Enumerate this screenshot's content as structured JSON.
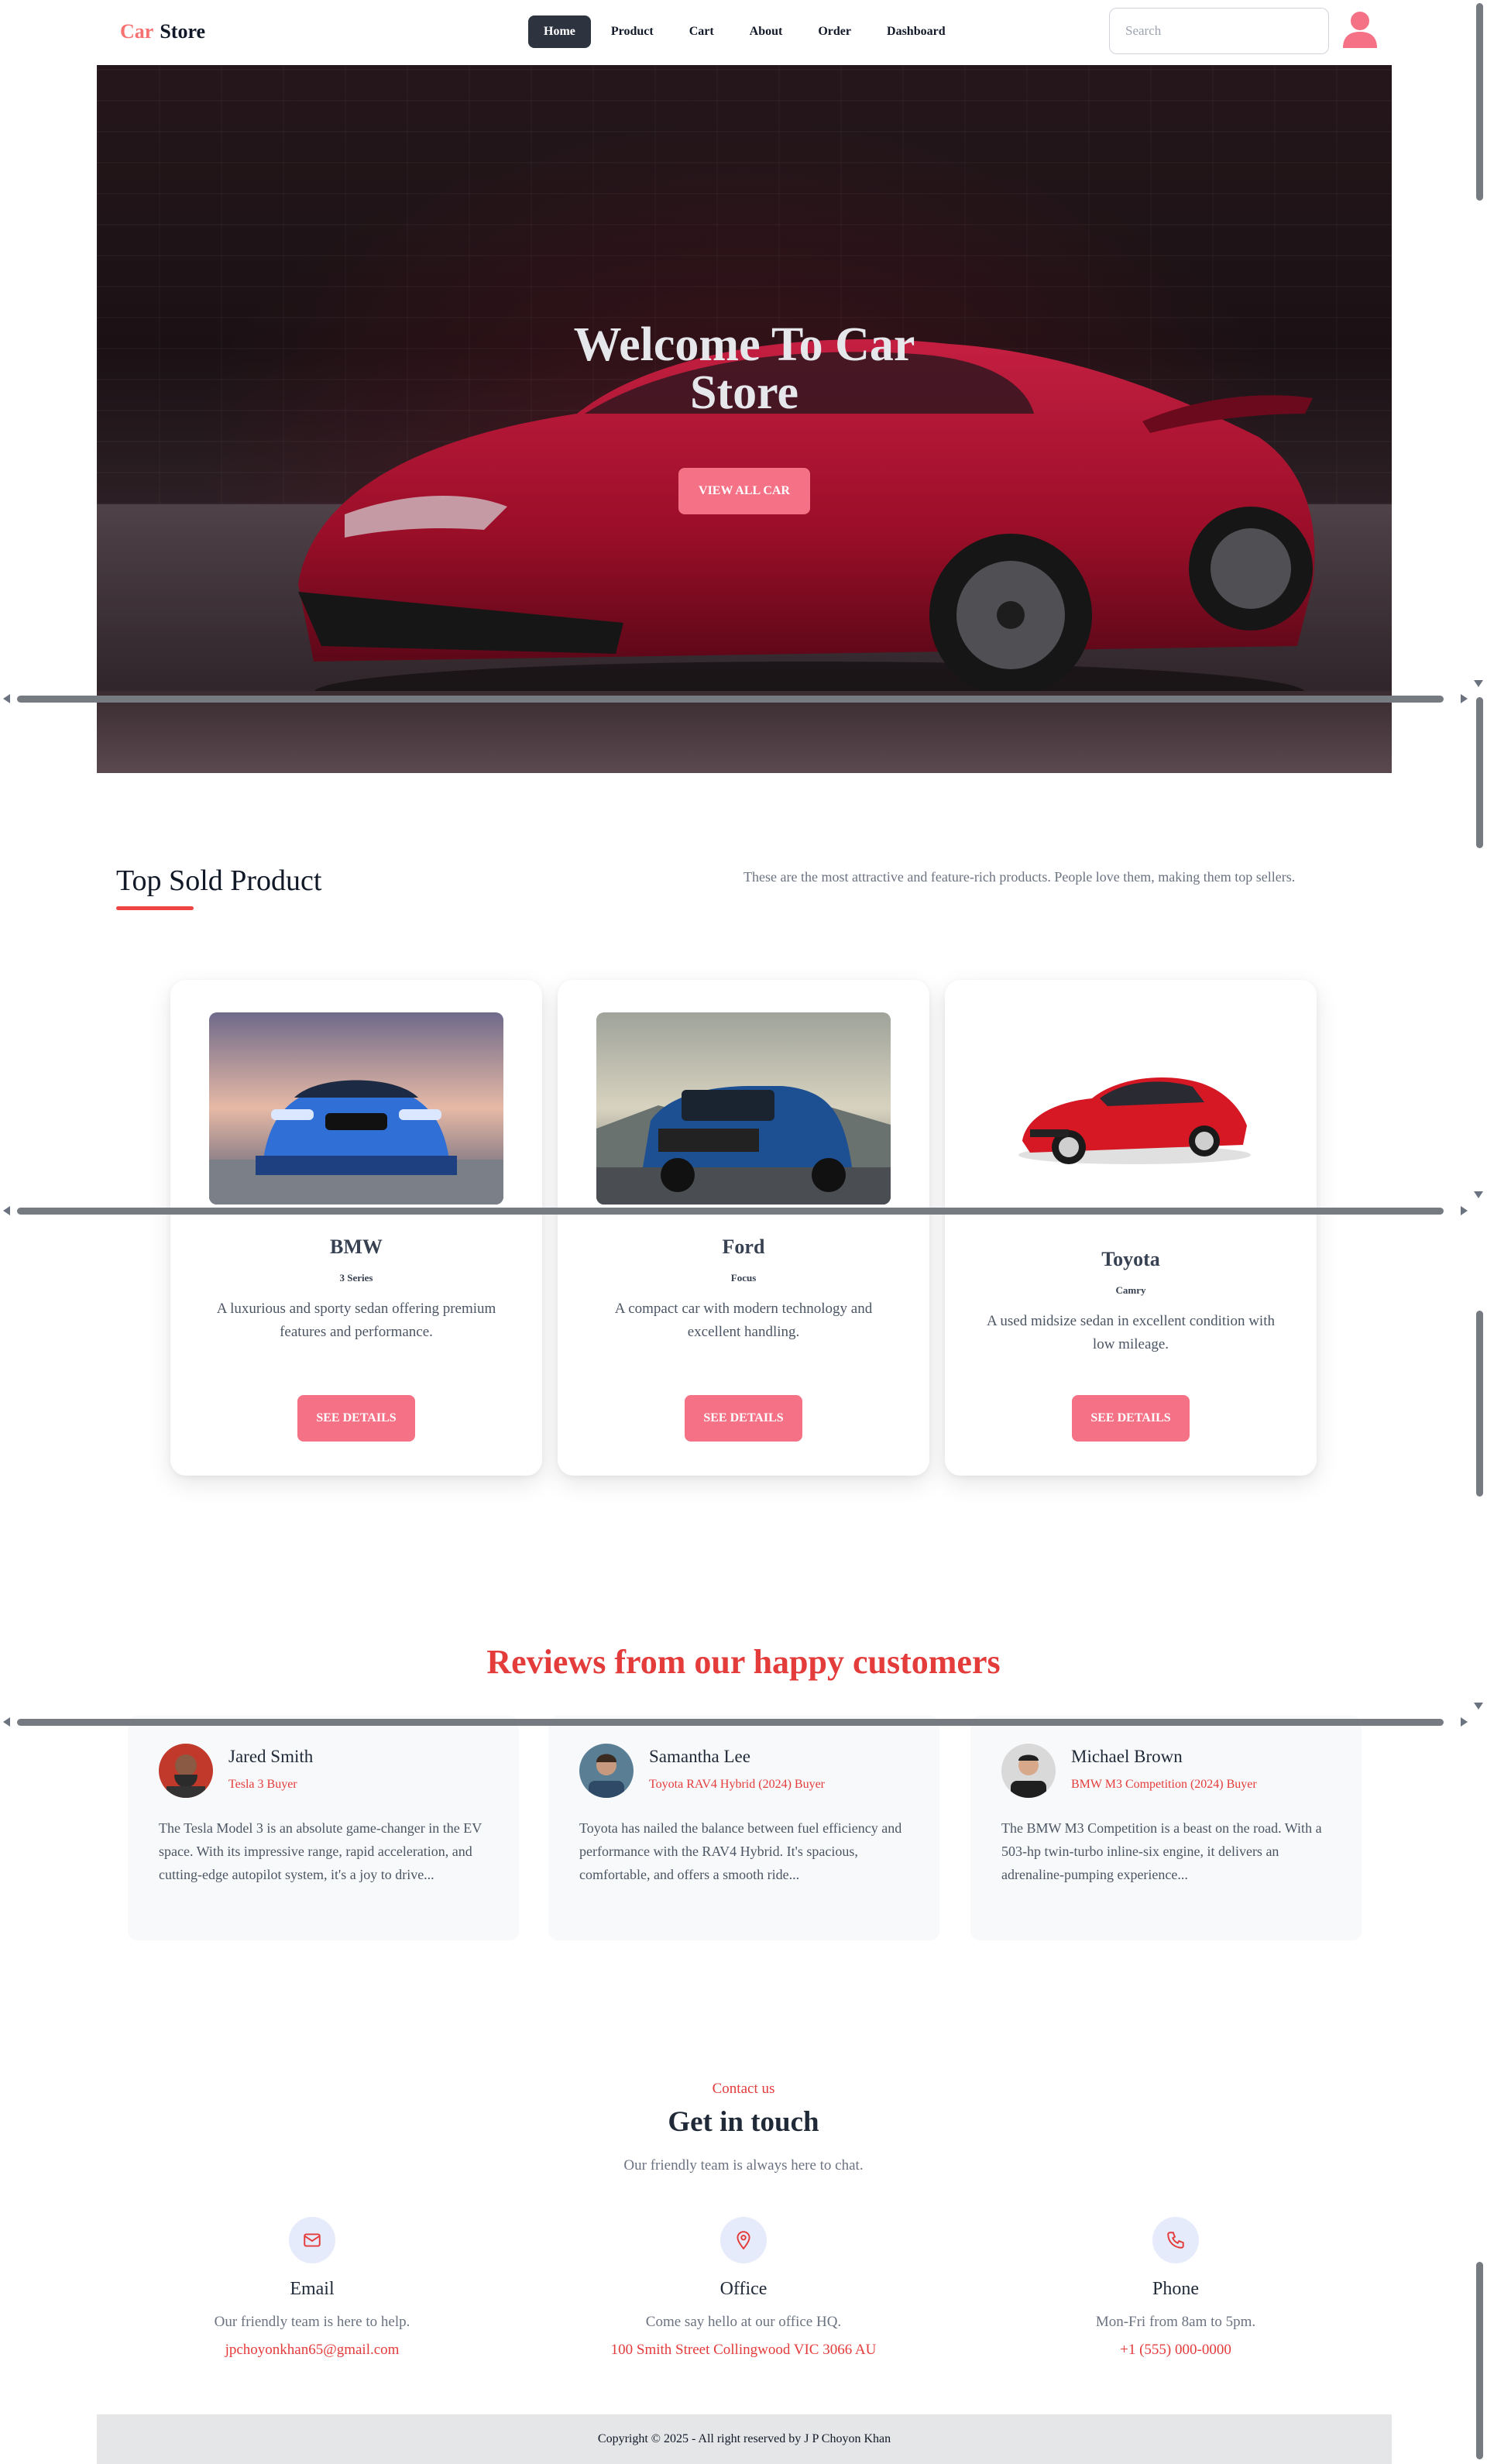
{
  "nav": {
    "logo_car": "Car",
    "logo_store": "Store",
    "items": [
      {
        "label": "Home",
        "active": true
      },
      {
        "label": "Product",
        "active": false
      },
      {
        "label": "Cart",
        "active": false
      },
      {
        "label": "About",
        "active": false
      },
      {
        "label": "Order",
        "active": false
      },
      {
        "label": "Dashboard",
        "active": false
      }
    ],
    "search_placeholder": "Search",
    "user_icon": "user-icon"
  },
  "hero": {
    "title": "Welcome To Car Store",
    "button": "VIEW ALL CAR"
  },
  "top_sold": {
    "title": "Top Sold Product",
    "subtitle": "These are the most attractive and feature-rich products. People love them, making them top sellers.",
    "cards": [
      {
        "brand": "BMW",
        "model": "3 Series",
        "description": "A luxurious and sporty sedan offering premium features and performance.",
        "button": "SEE DETAILS"
      },
      {
        "brand": "Ford",
        "model": "Focus",
        "description": "A compact car with modern technology and excellent handling.",
        "button": "SEE DETAILS"
      },
      {
        "brand": "Toyota",
        "model": "Camry",
        "description": "A used midsize sedan in excellent condition with low mileage.",
        "button": "SEE DETAILS"
      }
    ]
  },
  "reviews": {
    "title": "Reviews from our happy customers",
    "items": [
      {
        "name": "Jared Smith",
        "role": "Tesla 3 Buyer",
        "text": "The Tesla Model 3 is an absolute game-changer in the EV space. With its impressive range, rapid acceleration, and cutting-edge autopilot system, it's a joy to drive..."
      },
      {
        "name": "Samantha Lee",
        "role": "Toyota RAV4 Hybrid (2024) Buyer",
        "text": "Toyota has nailed the balance between fuel efficiency and performance with the RAV4 Hybrid. It's spacious, comfortable, and offers a smooth ride..."
      },
      {
        "name": "Michael Brown",
        "role": "BMW M3 Competition (2024) Buyer",
        "text": "The BMW M3 Competition is a beast on the road. With a 503-hp twin-turbo inline-six engine, it delivers an adrenaline-pumping experience..."
      }
    ]
  },
  "contact": {
    "pre": "Contact us",
    "title": "Get in touch",
    "subtitle": "Our friendly team is always here to chat.",
    "items": [
      {
        "icon": "mail-icon",
        "label": "Email",
        "description": "Our friendly team is here to help.",
        "link": "jpchoyonkhan65@gmail.com"
      },
      {
        "icon": "map-pin-icon",
        "label": "Office",
        "description": "Come say hello at our office HQ.",
        "link": "100 Smith Street Collingwood VIC 3066 AU"
      },
      {
        "icon": "phone-icon",
        "label": "Phone",
        "description": "Mon-Fri from 8am to 5pm.",
        "link": "+1 (555) 000-0000"
      }
    ]
  },
  "footer": {
    "text": "Copyright © 2025 - All right reserved by J P Choyon Khan"
  },
  "colors": {
    "accent": "#f47186",
    "brand_red": "#e43b3b",
    "nav_active": "#2d3440"
  }
}
